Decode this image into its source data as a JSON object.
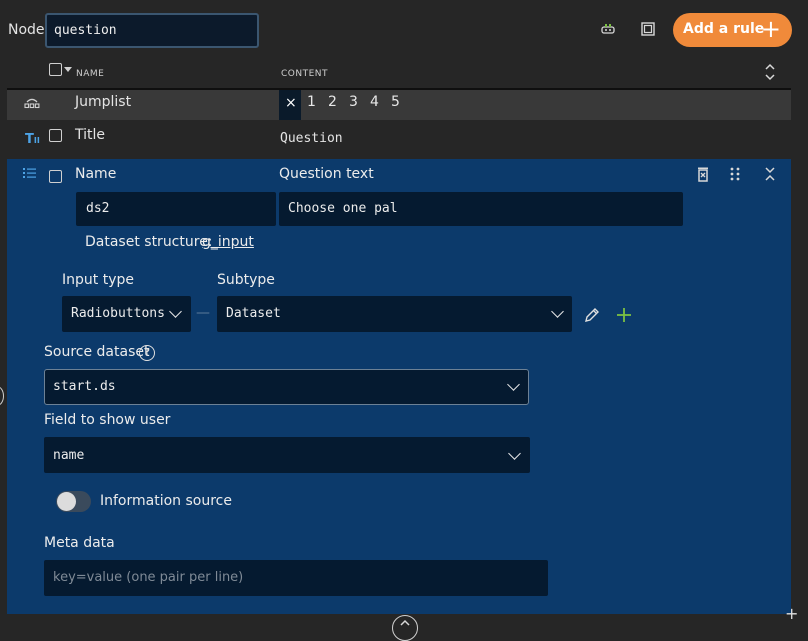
{
  "header": {
    "node_label": "Node",
    "node_value": "question",
    "add_rule_label": "Add a rule",
    "icons": [
      "robot-icon",
      "frame-icon",
      "plus-icon"
    ]
  },
  "columns": {
    "name": "NAME",
    "content": "CONTENT"
  },
  "rows": {
    "jumplist": {
      "name": "Jumplist",
      "close": "×",
      "pages": [
        "1",
        "2",
        "3",
        "4",
        "5"
      ]
    },
    "title": {
      "name": "Title",
      "content": "Question"
    }
  },
  "panel": {
    "name_label": "Name",
    "question_text_label": "Question text",
    "name_value": "ds2",
    "question_text_value": "Choose one pal",
    "dataset_structure_label": "Dataset structure:",
    "dataset_structure_link": "g_input",
    "input_type_label": "Input type",
    "input_type_value": "Radiobuttons",
    "dash": "—",
    "subtype_label": "Subtype",
    "subtype_value": "Dataset",
    "source_dataset_label": "Source dataset",
    "source_dataset_value": "start.ds",
    "field_to_show_label": "Field to show user",
    "field_to_show_value": "name",
    "information_source_label": "Information source",
    "information_source_on": false,
    "meta_data_label": "Meta data",
    "meta_data_placeholder": "key=value (one pair per line)"
  },
  "colors": {
    "accent": "#f08a3a",
    "panel": "#0c3a6b",
    "field": "#051a30",
    "background": "#262626"
  }
}
